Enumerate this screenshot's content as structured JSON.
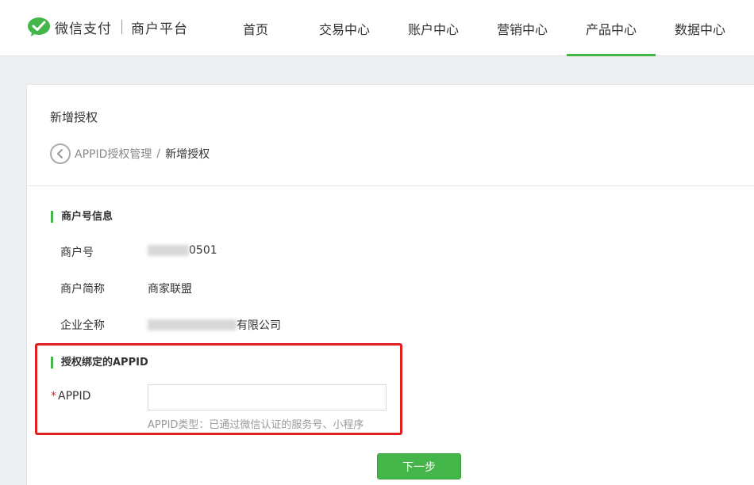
{
  "header": {
    "brand": "微信支付",
    "platform": "商户平台",
    "nav": [
      {
        "label": "首页"
      },
      {
        "label": "交易中心"
      },
      {
        "label": "账户中心"
      },
      {
        "label": "营销中心"
      },
      {
        "label": "产品中心",
        "active": true
      },
      {
        "label": "数据中心"
      }
    ]
  },
  "page": {
    "title": "新增授权",
    "breadcrumb": {
      "parent": "APPID授权管理",
      "separator": "/",
      "current": "新增授权"
    }
  },
  "merchant_info": {
    "section_title": "商户号信息",
    "rows": [
      {
        "label": "商户号",
        "value_visible": "0501"
      },
      {
        "label": "商户简称",
        "value": "商家联盟"
      },
      {
        "label": "企业全称",
        "value_visible": "有限公司"
      }
    ]
  },
  "appid_binding": {
    "section_title": "授权绑定的APPID",
    "required_mark": "*",
    "field_label": "APPID",
    "value": "",
    "hint": "APPID类型：已通过微信认证的服务号、小程序"
  },
  "actions": {
    "next_label": "下一步"
  },
  "colors": {
    "accent": "#44b549",
    "highlight_border": "#e02020"
  }
}
